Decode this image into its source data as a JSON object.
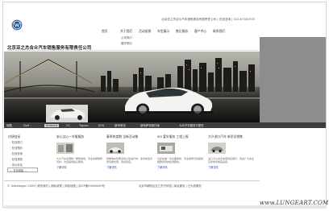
{
  "header": {
    "topline": "北京亚之杰合众汽车销售服务有限责任公司 | 在线咨询 | 010-67361970",
    "nav": [
      "首页",
      "关于我们",
      "活动促销",
      "车型展示",
      "售后服务",
      "客户中心",
      "联系我们"
    ],
    "submenu": [
      "公司简介",
      "展厅照片"
    ]
  },
  "company": {
    "title": "北京亚之杰合众汽车销售服务有限责任公司"
  },
  "model_bar": {
    "items": [
      "尚酷",
      "Golf",
      "Scirocco",
      "CC",
      "Tiguan",
      "EOS",
      "新甲壳虫",
      "新帕萨特旅行版",
      "大众汽车服务与配件"
    ],
    "active": "Scirocco"
  },
  "sidebar": {
    "title": "快捷链接",
    "links": [
      "在线预订",
      "在线预约",
      "在线咨询",
      "在线调查",
      "评价本站"
    ],
    "select": "--- 友情链接 ---"
  },
  "columns": [
    {
      "title": "安心点心一车服服务",
      "desc": "大众汽车全国统一服务热线，专业车辆维修养护，为您提供贴心服务。",
      "more": "了解详情"
    },
    {
      "title": "春季热卖期 全新活动推",
      "desc": "春季购车优惠活动火热进行中，多款车型享受专属优惠，欢迎到店。",
      "more": "了解详情"
    },
    {
      "title": "SEI 爱车服务 工程上报",
      "desc": "为爱车做一次全面体检，专业技师为您提供细致周到的检测服务。",
      "more": "了解详情"
    },
    {
      "title": "大众进口汽车 新学员销售",
      "desc": "进口大众全系车型到店展示，欢迎广大车主及新学员前来品鉴。",
      "more": "了解详情"
    }
  ],
  "footer": {
    "left": "© Volkswagen 2009 | 联系我们 | 隐私政策 | 网站地图 | 京ICP备09000000号",
    "right": "北京市朝阳区亚之杰汽车园 | 新址服务 | 已为您服务"
  },
  "watermark": "www.LUNGEART.COM",
  "colors": {
    "nav_bar": "#3e3e3e",
    "gray_area": "#8d8d8d",
    "link": "#2a5aa8"
  }
}
